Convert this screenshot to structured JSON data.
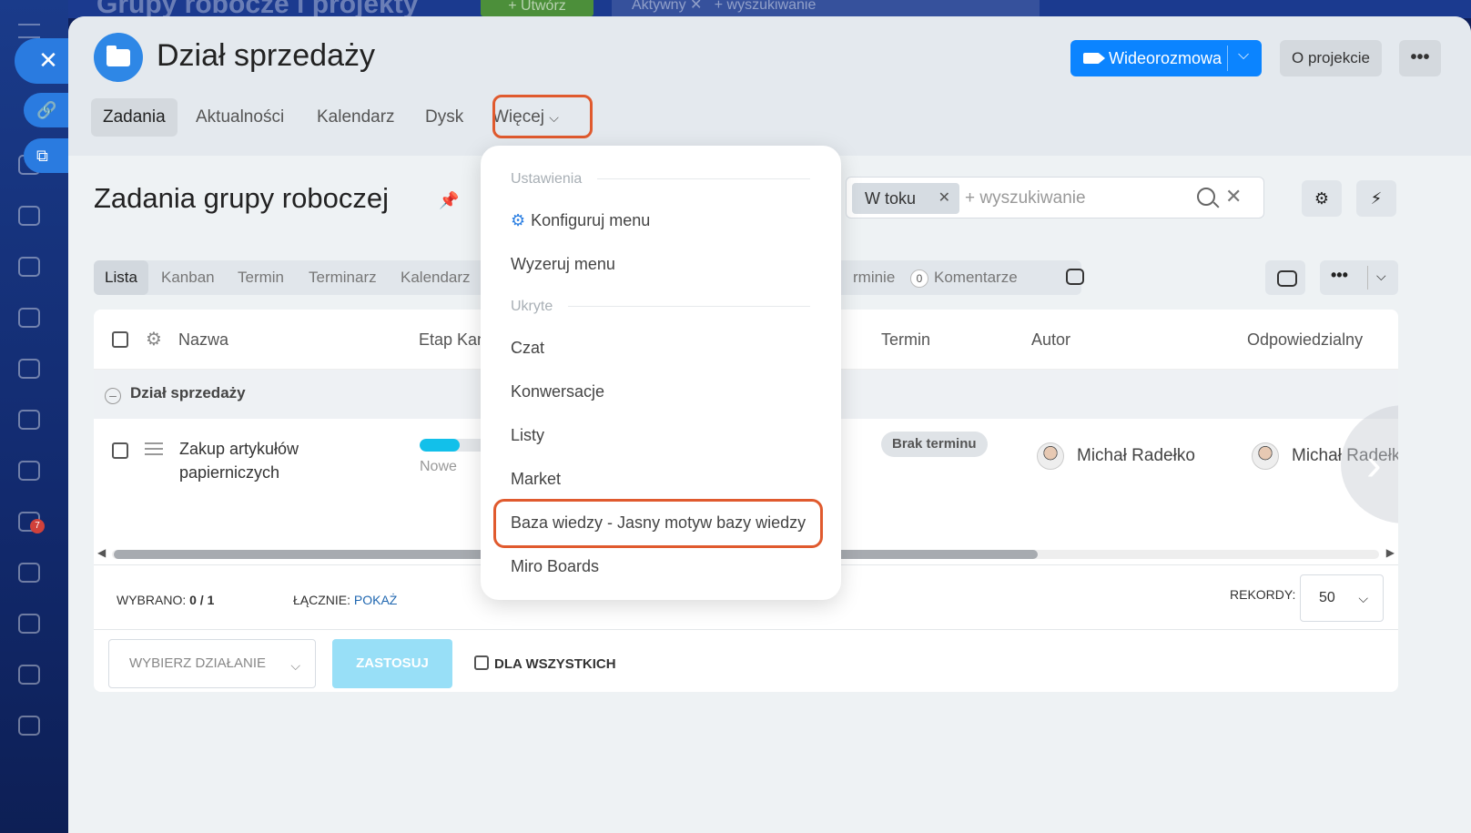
{
  "background": {
    "title": "Grupy robocze i projekty",
    "create_label": "Utwórz",
    "filter_chip": "Aktywny",
    "search_placeholder": "+ wyszukiwanie",
    "notification_count": "7"
  },
  "header": {
    "title": "Dział sprzedaży",
    "video_button": "Wideorozmowa",
    "about_button": "O projekcie",
    "more_button": "•••"
  },
  "nav_tabs": [
    {
      "label": "Zadania",
      "active": true
    },
    {
      "label": "Aktualności"
    },
    {
      "label": "Kalendarz"
    },
    {
      "label": "Dysk"
    },
    {
      "label": "Więcej"
    }
  ],
  "section": {
    "title": "Zadania grupy roboczej"
  },
  "search": {
    "chip": "W toku",
    "placeholder": "wyszukiwanie",
    "plus": "+"
  },
  "views": [
    {
      "label": "Lista",
      "active": true
    },
    {
      "label": "Kanban"
    },
    {
      "label": "Termin"
    },
    {
      "label": "Terminarz"
    },
    {
      "label": "Kalendarz"
    },
    {
      "label": "rminie"
    },
    {
      "label": "Komentarze",
      "count": "0"
    }
  ],
  "table": {
    "columns": [
      "Nazwa",
      "Etap Kan",
      "Termin",
      "Autor",
      "Odpowiedzialny"
    ],
    "group": "Dział sprzedaży",
    "rows": [
      {
        "name": "Zakup artykułów papierniczych",
        "stage": "Nowe",
        "stage_progress": 0.55,
        "deadline": "Brak terminu",
        "author": "Michał Radełko",
        "responsible": "Michał Radełko"
      }
    ]
  },
  "footer": {
    "selected_label": "WYBRANO:",
    "selected_value": "0 / 1",
    "total_label": "ŁĄCZNIE:",
    "total_link": "POKAŻ",
    "records_label": "REKORDY:",
    "records_value": "50",
    "action_placeholder": "WYBIERZ DZIAŁANIE",
    "apply_button": "ZASTOSUJ",
    "for_all_label": "DLA WSZYSTKICH"
  },
  "dropdown": {
    "section_settings": "Ustawienia",
    "configure_menu": "Konfiguruj menu",
    "reset_menu": "Wyzeruj menu",
    "section_hidden": "Ukryte",
    "items": [
      "Czat",
      "Konwersacje",
      "Listy",
      "Market",
      "Baza wiedzy - Jasny motyw bazy wiedzy",
      "Miro Boards"
    ]
  },
  "colors": {
    "accent": "#0b84ff",
    "highlight": "#e05a2e",
    "progress": "#12c0ea"
  }
}
